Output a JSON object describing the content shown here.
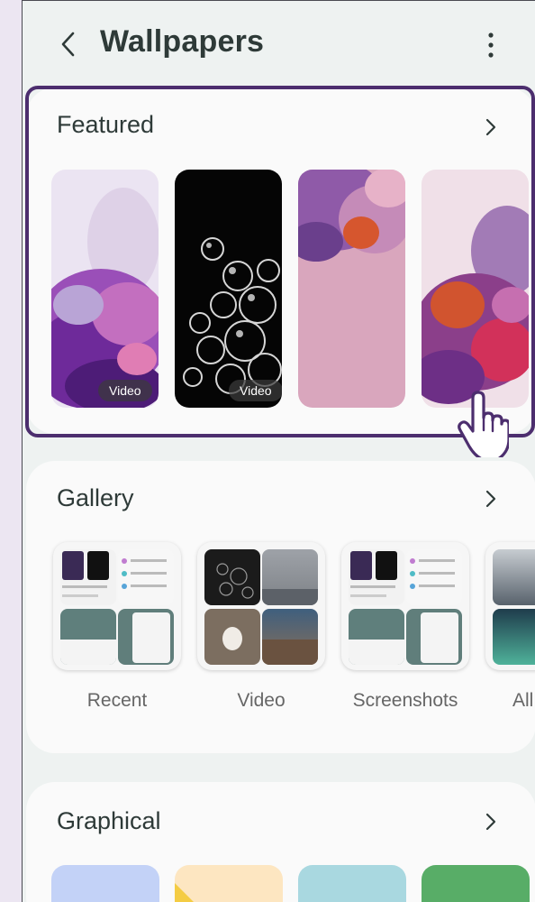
{
  "appbar": {
    "title": "Wallpapers",
    "back_icon": "back-arrow-icon",
    "more_icon": "more-vertical-icon"
  },
  "featured": {
    "title": "Featured",
    "items": [
      {
        "name": "Featured wallpaper 1",
        "badge": "Video"
      },
      {
        "name": "Featured wallpaper 2",
        "badge": "Video"
      },
      {
        "name": "Featured wallpaper 3",
        "badge": ""
      },
      {
        "name": "Featured wallpaper 4",
        "badge": ""
      }
    ]
  },
  "gallery": {
    "title": "Gallery",
    "albums": [
      {
        "label": "Recent"
      },
      {
        "label": "Video"
      },
      {
        "label": "Screenshots"
      },
      {
        "label": "All"
      }
    ]
  },
  "graphical": {
    "title": "Graphical",
    "swatches": [
      "#c3d2f7",
      "#fde6c1",
      "#a9d8e0",
      "#58ad67"
    ]
  },
  "colors": {
    "accent_outline": "#4c2e6e",
    "background": "#eef2f1",
    "card": "#fafafa"
  }
}
